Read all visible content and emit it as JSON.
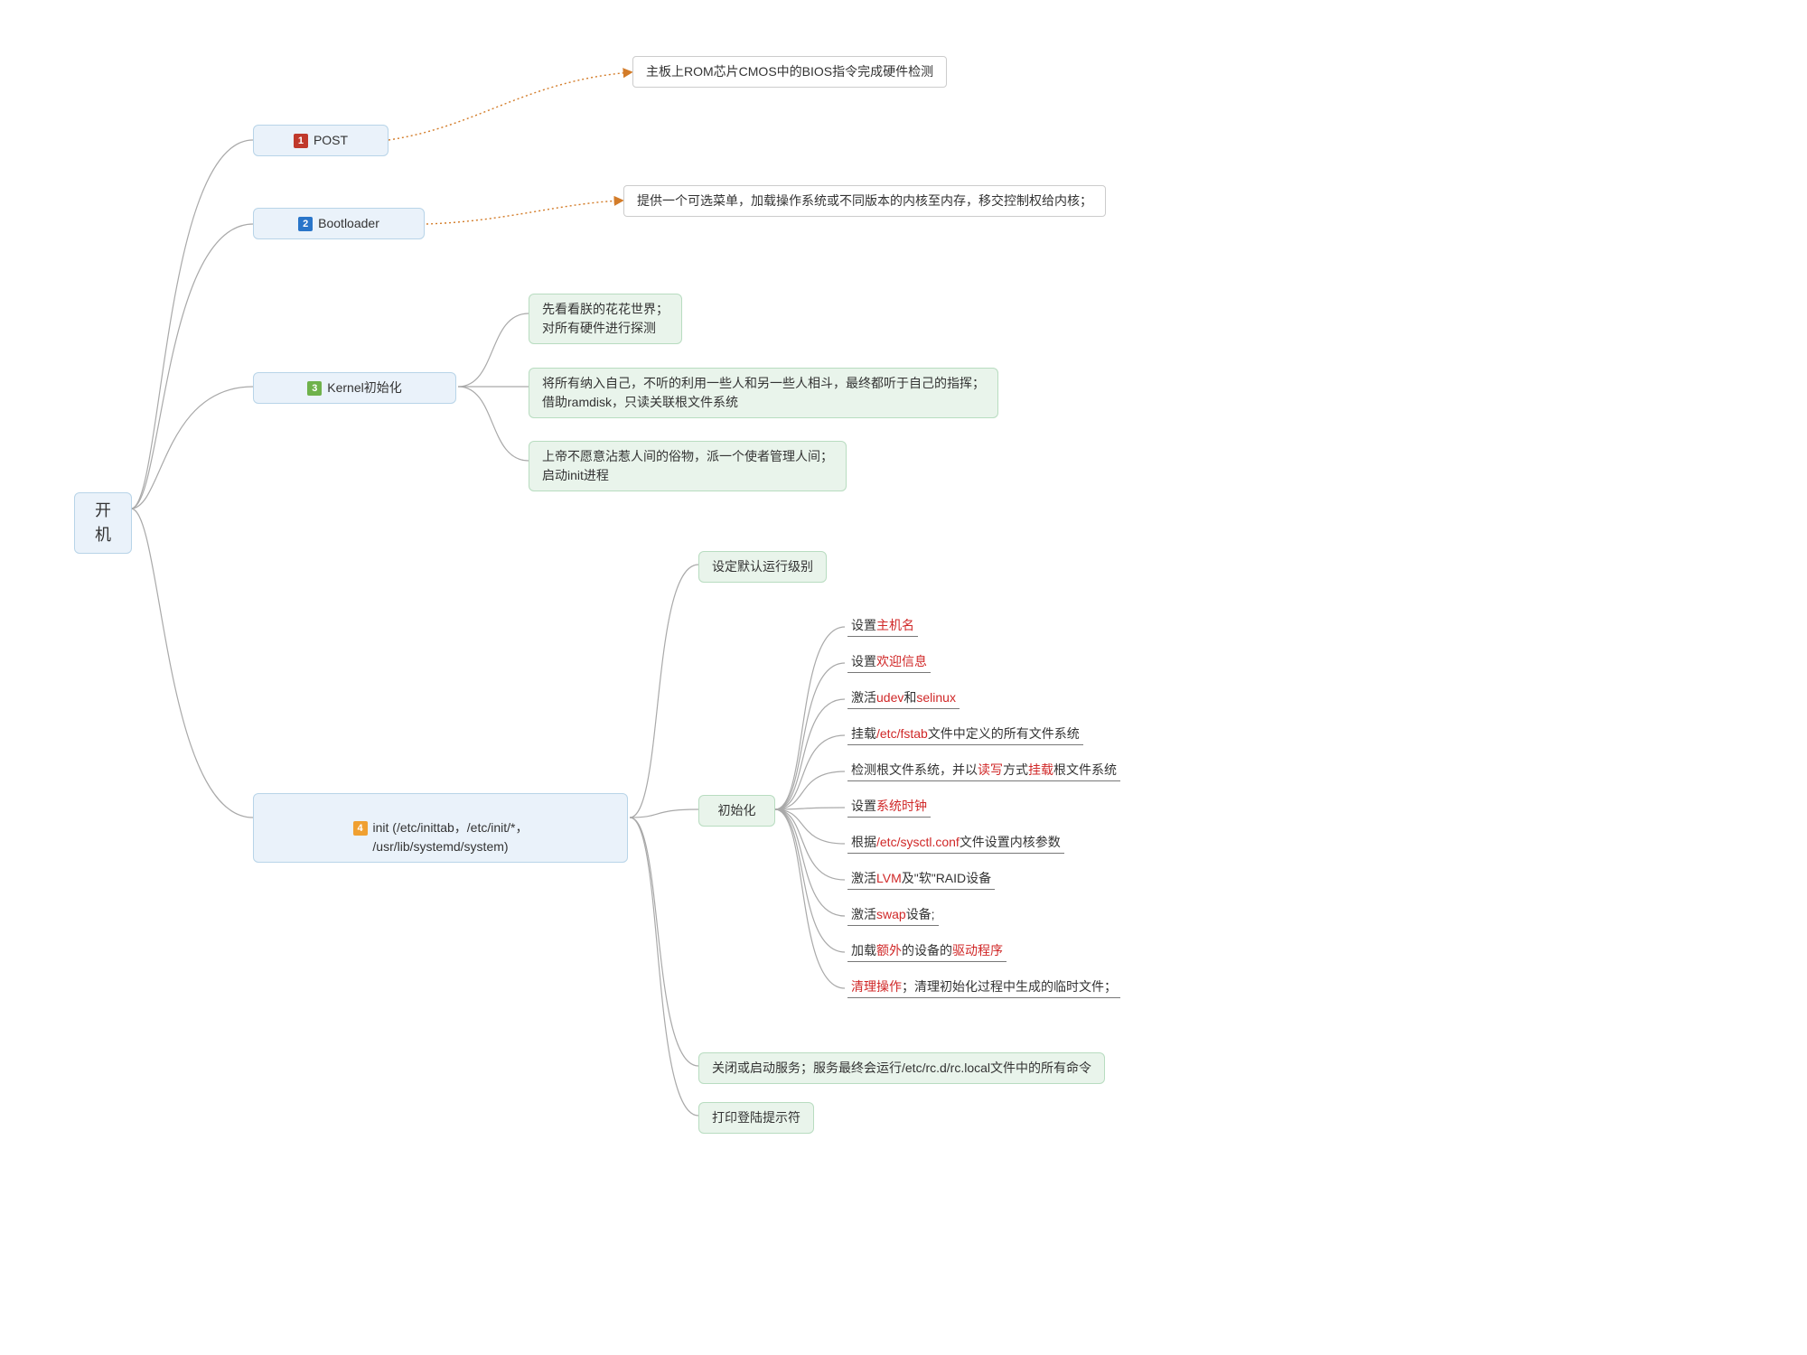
{
  "root": "开机",
  "n1": {
    "num": "1",
    "label": "POST",
    "note": "主板上ROM芯片CMOS中的BIOS指令完成硬件检测"
  },
  "n2": {
    "num": "2",
    "label": "Bootloader",
    "note": "提供一个可选菜单，加载操作系统或不同版本的内核至内存，移交控制权给内核；"
  },
  "n3": {
    "num": "3",
    "label": "Kernel初始化",
    "a": "先看看朕的花花世界；\n对所有硬件进行探测",
    "b": "将所有纳入自己，不听的利用一些人和另一些人相斗，最终都听于自己的指挥；\n借助ramdisk，只读关联根文件系统",
    "c": "上帝不愿意沾惹人间的俗物，派一个使者管理人间；\n启动init进程"
  },
  "n4": {
    "num": "4",
    "label": "init (/etc/inittab，/etc/init/*，\n/usr/lib/systemd/system)",
    "g1": "设定默认运行级别",
    "g2": "初始化",
    "g3": "关闭或启动服务；服务最终会运行/etc/rc.d/rc.local文件中的所有命令",
    "g4": "打印登陆提示符",
    "init": {
      "i1": {
        "p": "设置",
        "r": "主机名"
      },
      "i2": {
        "p": "设置",
        "r": "欢迎信息"
      },
      "i3": {
        "p": "激活",
        "r1": "udev",
        "m": "和",
        "r2": "selinux"
      },
      "i4": {
        "p": "挂载",
        "r": "/etc/fstab",
        "s": "文件中定义的所有文件系统"
      },
      "i5": {
        "p": "检测根文件系统，并以",
        "r1": "读写",
        "m": "方式",
        "r2": "挂载",
        "s": "根文件系统"
      },
      "i6": {
        "p": "设置",
        "r": "系统时钟"
      },
      "i7": {
        "p": "根据",
        "r": "/etc/sysctl.conf",
        "s": "文件设置内核参数"
      },
      "i8": {
        "p": "激活",
        "r": "LVM",
        "s": "及\"软\"RAID设备"
      },
      "i9": {
        "p": "激活",
        "r": "swap",
        "s": "设备;"
      },
      "i10": {
        "p": "加载",
        "r1": "额外",
        "m": "的设备的",
        "r2": "驱动程序"
      },
      "i11": {
        "r": "清理操作",
        "s": "；清理初始化过程中生成的临时文件；"
      }
    }
  }
}
